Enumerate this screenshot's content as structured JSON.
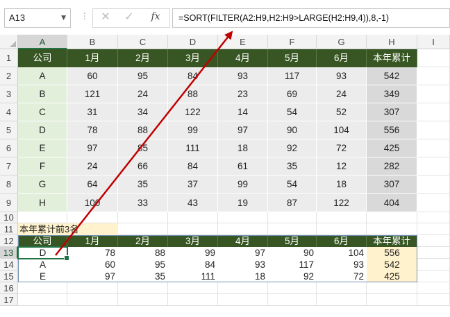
{
  "formula_bar": {
    "name_box": "A13",
    "cancel_icon": "✕",
    "enter_icon": "✓",
    "fx_label": "fx",
    "formula": "=SORT(FILTER(A2:H9,H2:H9>LARGE(H2:H9,4)),8,-1)"
  },
  "columns": [
    "A",
    "B",
    "C",
    "D",
    "E",
    "F",
    "G",
    "H",
    "I"
  ],
  "rows": [
    "1",
    "2",
    "3",
    "4",
    "5",
    "6",
    "7",
    "8",
    "9",
    "10",
    "11",
    "12",
    "13",
    "14",
    "15",
    "16",
    "17"
  ],
  "table1": {
    "headers": [
      "公司",
      "1月",
      "2月",
      "3月",
      "4月",
      "5月",
      "6月",
      "本年累计"
    ],
    "rows": [
      [
        "A",
        "60",
        "95",
        "84",
        "93",
        "117",
        "93",
        "542"
      ],
      [
        "B",
        "121",
        "24",
        "88",
        "23",
        "69",
        "24",
        "349"
      ],
      [
        "C",
        "31",
        "34",
        "122",
        "14",
        "54",
        "52",
        "307"
      ],
      [
        "D",
        "78",
        "88",
        "99",
        "97",
        "90",
        "104",
        "556"
      ],
      [
        "E",
        "97",
        "85",
        "111",
        "18",
        "92",
        "72",
        "425"
      ],
      [
        "F",
        "24",
        "66",
        "84",
        "61",
        "35",
        "12",
        "282"
      ],
      [
        "G",
        "64",
        "35",
        "37",
        "99",
        "54",
        "18",
        "307"
      ],
      [
        "H",
        "100",
        "33",
        "43",
        "19",
        "87",
        "122",
        "404"
      ]
    ]
  },
  "label_row11": "本年累计前3名",
  "table2": {
    "headers": [
      "公司",
      "1月",
      "2月",
      "3月",
      "4月",
      "5月",
      "6月",
      "本年累计"
    ],
    "rows": [
      [
        "D",
        "78",
        "88",
        "99",
        "97",
        "90",
        "104",
        "556"
      ],
      [
        "A",
        "60",
        "95",
        "84",
        "93",
        "117",
        "93",
        "542"
      ],
      [
        "E",
        "97",
        "35",
        "111",
        "18",
        "92",
        "72",
        "425"
      ]
    ]
  },
  "colors": {
    "header_green": "#375623",
    "col_a_fill": "#e2efda",
    "col_h_fill": "#d9d9d9",
    "body_fill": "#ececec",
    "highlight_fill": "#fff2cc",
    "arrow_red": "#c00000",
    "selection_green": "#217346"
  }
}
